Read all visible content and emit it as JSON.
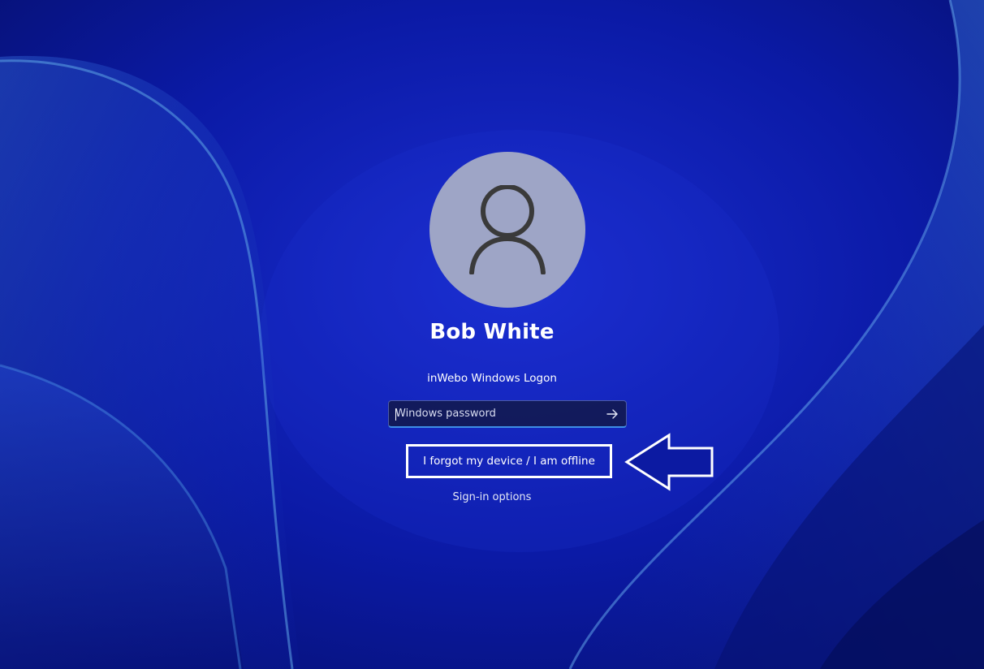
{
  "user": {
    "name": "Bob White"
  },
  "logon": {
    "provider_label": "inWebo Windows Logon",
    "password_placeholder": "Windows password",
    "password_value": "",
    "forgot_link": "I forgot my device / I am offline",
    "signin_options": "Sign-in options"
  },
  "icons": {
    "avatar": "person-icon",
    "submit": "arrow-right-icon",
    "annotation": "arrow-left-outline-icon"
  },
  "colors": {
    "background": "#0a1aa0",
    "avatar_bg": "#9ea5c6",
    "input_accent": "#3e8ee6",
    "text": "#ffffff"
  }
}
